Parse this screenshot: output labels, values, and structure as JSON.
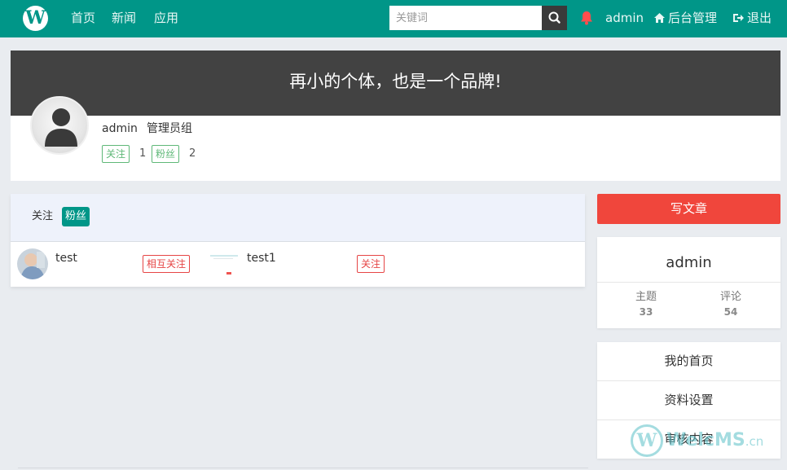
{
  "topbar": {
    "logo_letter": "W",
    "nav": [
      "首页",
      "新闻",
      "应用"
    ],
    "search_placeholder": "关键词",
    "user": "admin",
    "admin_link": "后台管理",
    "logout_link": "退出",
    "bg_color": "#009688"
  },
  "profile": {
    "slogan": "再小的个体，也是一个品牌!",
    "name": "admin",
    "group": "管理员组",
    "following_label": "关注",
    "following_count": "1",
    "fans_label": "粉丝",
    "fans_count": "2"
  },
  "follow_panel": {
    "tabs": [
      "关注",
      "粉丝"
    ],
    "active_tab": "粉丝",
    "users": [
      {
        "name": "test",
        "action": "相互关注"
      },
      {
        "name": "test1",
        "action": "关注"
      }
    ]
  },
  "sidebar": {
    "write_button": "写文章",
    "write_color": "#f0463c",
    "username": "admin",
    "stats": [
      {
        "label": "主题",
        "value": "33"
      },
      {
        "label": "评论",
        "value": "54"
      }
    ],
    "menu": [
      "我的首页",
      "资料设置",
      "审核内容"
    ]
  },
  "watermark": {
    "letter": "W",
    "text_main": "WelcMS",
    "text_suffix": ".cn"
  }
}
